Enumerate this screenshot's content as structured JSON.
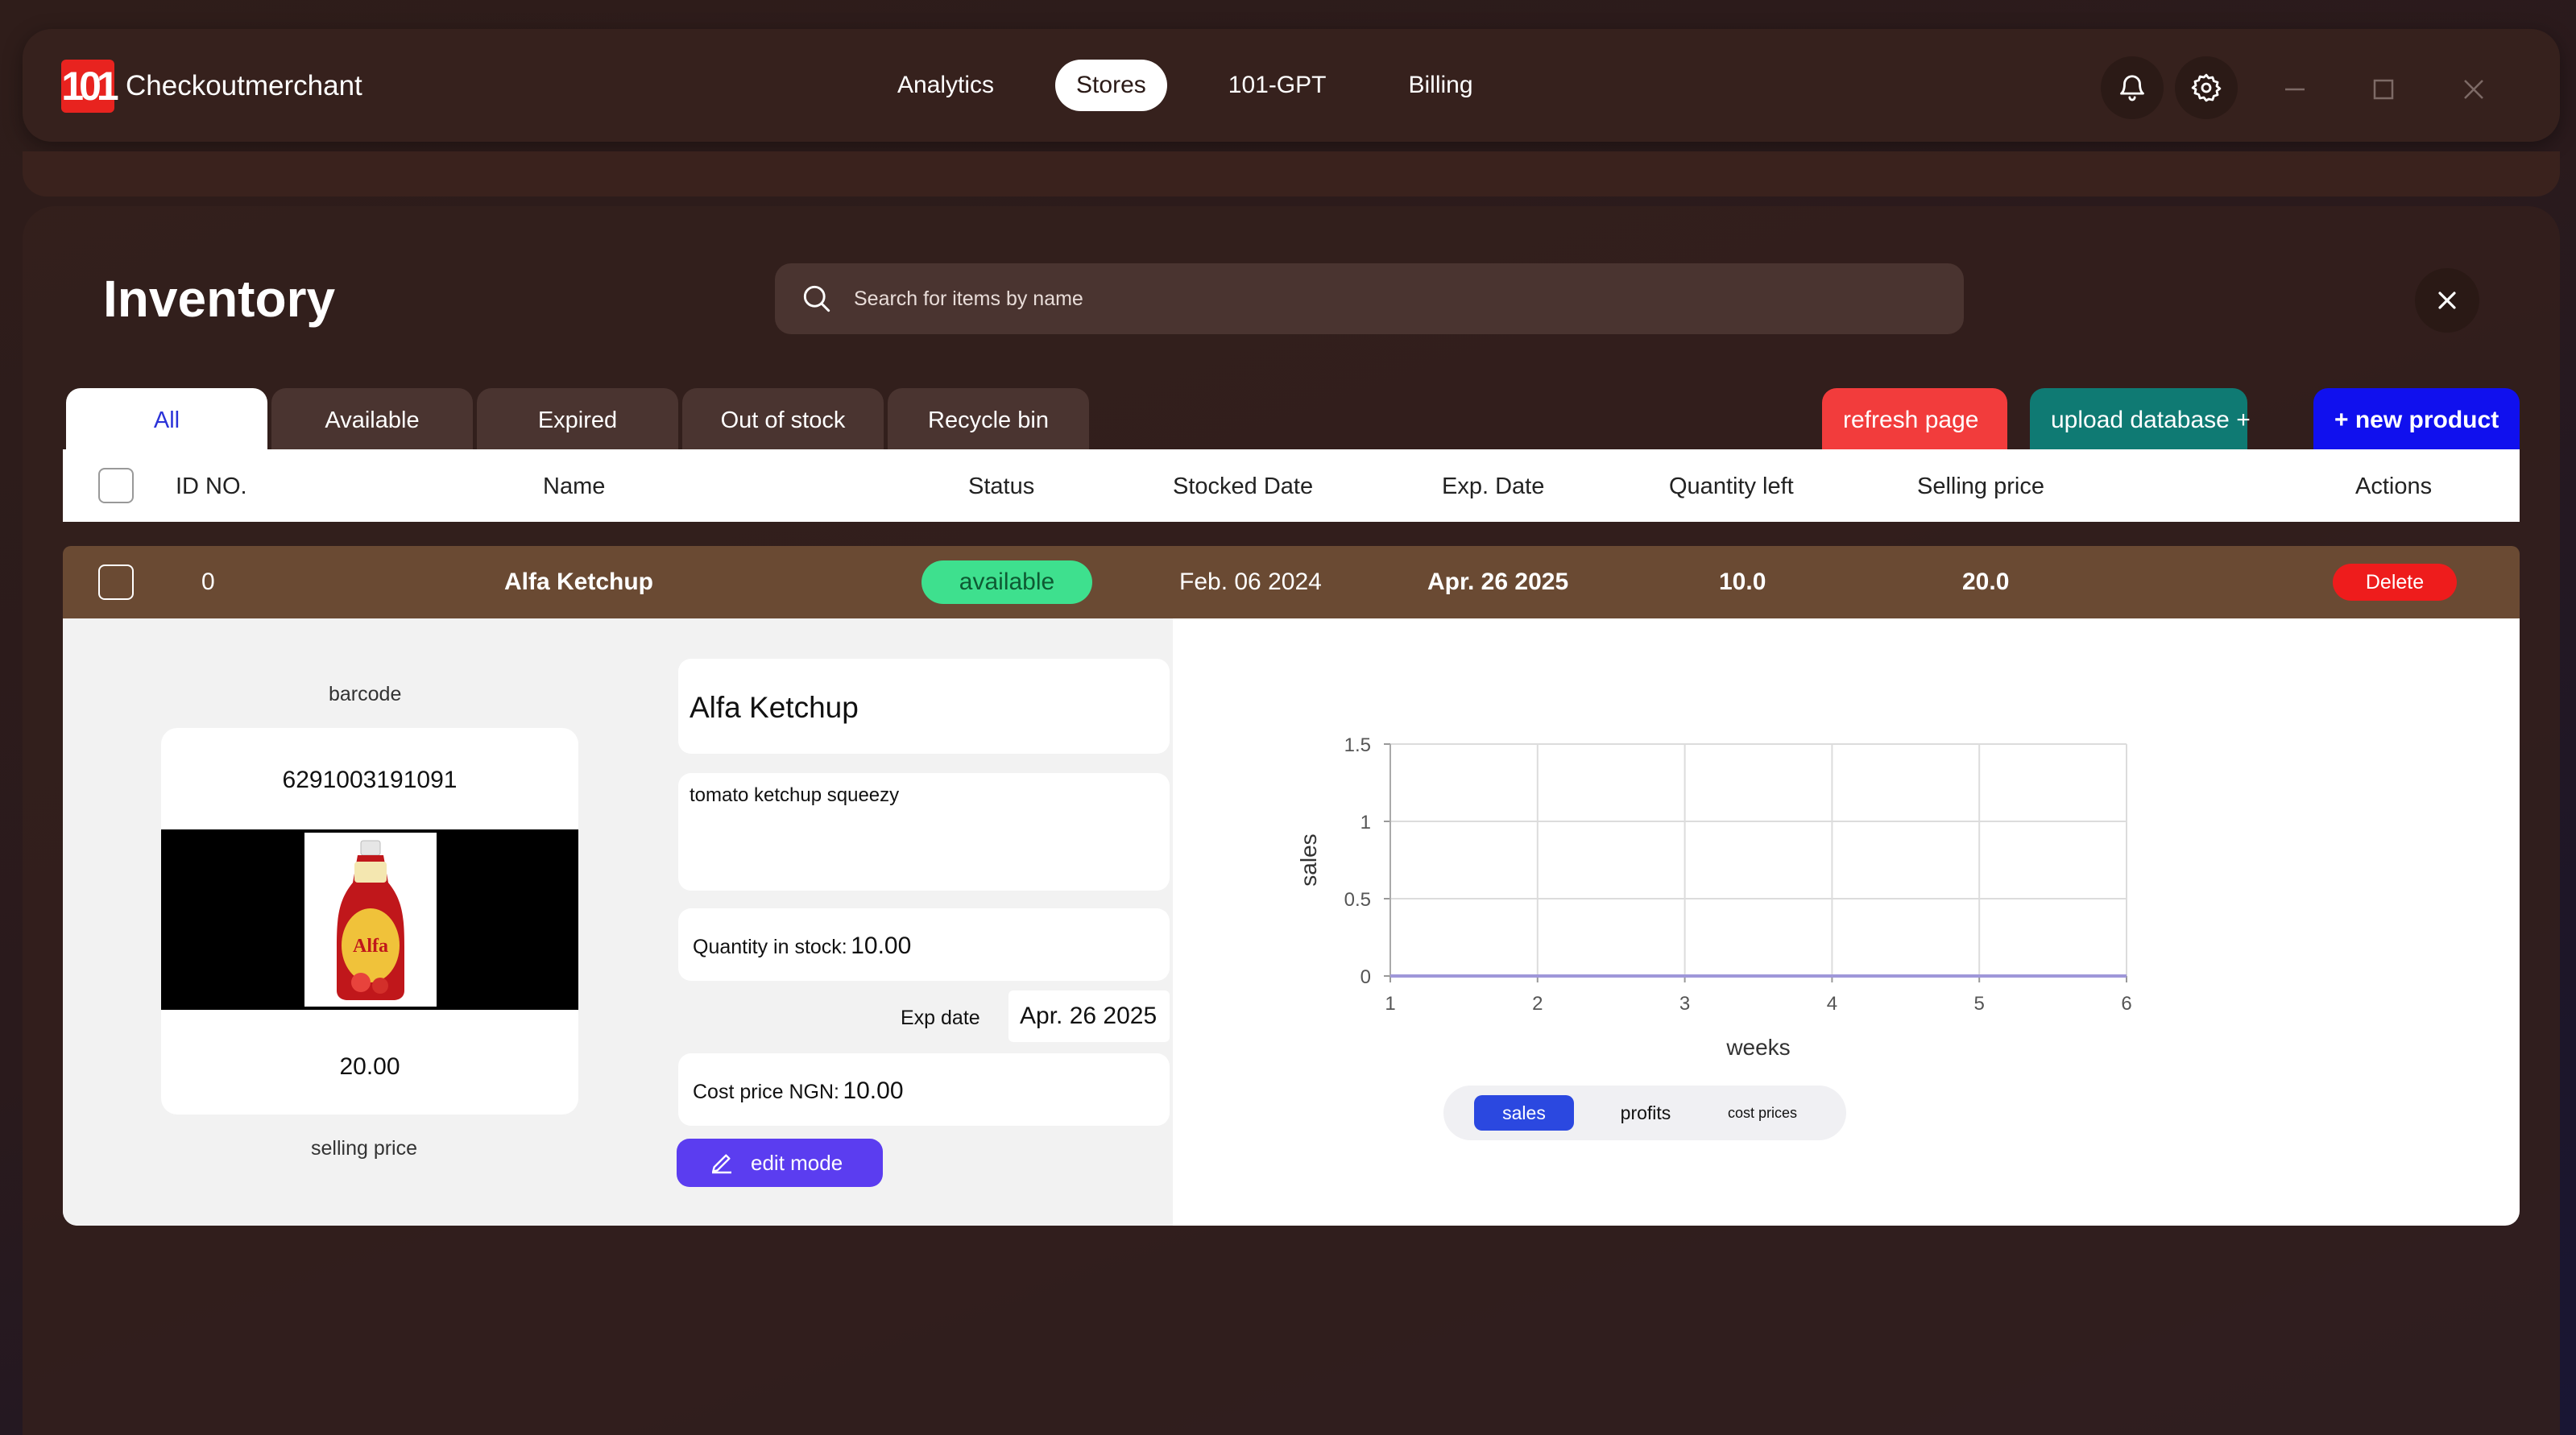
{
  "app": {
    "name": "Checkoutmerchant",
    "logo_text": "101"
  },
  "nav": {
    "items": [
      {
        "label": "Analytics",
        "active": false
      },
      {
        "label": "Stores",
        "active": true
      },
      {
        "label": "101-GPT",
        "active": false
      },
      {
        "label": "Billing",
        "active": false
      }
    ]
  },
  "top_icons": [
    "bell-icon",
    "gear-icon"
  ],
  "window_controls": [
    "minimize-icon",
    "maximize-icon",
    "close-icon"
  ],
  "page": {
    "title": "Inventory",
    "search_placeholder": "Search for items by name"
  },
  "tabs": [
    {
      "label": "All",
      "active": true
    },
    {
      "label": "Available",
      "active": false
    },
    {
      "label": "Expired",
      "active": false
    },
    {
      "label": "Out of stock",
      "active": false
    },
    {
      "label": "Recycle bin",
      "active": false
    }
  ],
  "actions": {
    "refresh": "refresh page",
    "upload": "upload database +",
    "new_product": "+ new product"
  },
  "table": {
    "columns": [
      "ID NO.",
      "Name",
      "Status",
      "Stocked Date",
      "Exp. Date",
      "Quantity left",
      "Selling price",
      "Actions"
    ],
    "row": {
      "id": "0",
      "name": "Alfa Ketchup",
      "status": "available",
      "stocked_date": "Feb. 06 2024",
      "exp_date": "Apr. 26 2025",
      "quantity_left": "10.0",
      "selling_price": "20.0",
      "action": "Delete"
    }
  },
  "detail": {
    "barcode_label": "barcode",
    "barcode": "6291003191091",
    "card_price": "20.00",
    "selling_price_label": "selling price",
    "product_name": "Alfa Ketchup",
    "description": "tomato ketchup squeezy",
    "qty_label": "Quantity in stock:",
    "qty_value": "10.00",
    "exp_label": "Exp date",
    "exp_value": "Apr. 26 2025",
    "cost_label": "Cost price NGN:",
    "cost_value": "10.00",
    "edit_label": "edit mode",
    "product_image_text": "Alfa"
  },
  "chart_toggle": [
    {
      "label": "sales",
      "active": true
    },
    {
      "label": "profits",
      "active": false
    },
    {
      "label": "cost prices",
      "active": false
    }
  ],
  "colors": {
    "status_available": "#3ee08e",
    "delete": "#ee1c1c",
    "refresh": "#f23c3c",
    "upload": "#0f7a73",
    "new_product": "#1010ee",
    "edit": "#5b3df0",
    "chart_line": "#9f97d9"
  },
  "chart_data": {
    "type": "line",
    "x": [
      1,
      2,
      3,
      4,
      5,
      6
    ],
    "series": [
      {
        "values": [
          0,
          0,
          0,
          0,
          0,
          0
        ]
      }
    ],
    "xlabel": "weeks",
    "ylabel": "sales",
    "xticks": [
      "1",
      "2",
      "3",
      "4",
      "5",
      "6"
    ],
    "yticks": [
      "0",
      "0.5",
      "1",
      "1.5"
    ],
    "xlim": [
      1,
      6
    ],
    "ylim": [
      0,
      1.5
    ],
    "grid": true
  }
}
